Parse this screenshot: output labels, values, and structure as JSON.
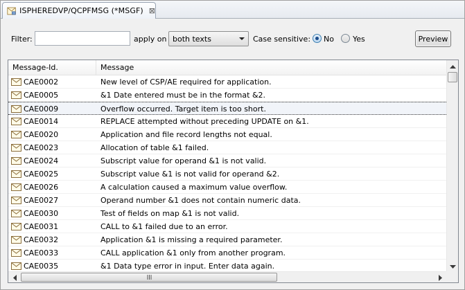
{
  "tab": {
    "title": "ISPHEREDVP/QCPFMSG (*MSGF)",
    "close_glyph": "⊠",
    "icon": "message-file-icon"
  },
  "filter": {
    "label": "Filter:",
    "value": "",
    "apply_on_label": "apply on",
    "apply_on_selected": "both texts",
    "case_label": "Case sensitive:",
    "options": [
      {
        "label": "No",
        "checked": true
      },
      {
        "label": "Yes",
        "checked": false
      }
    ],
    "preview_label": "Preview"
  },
  "table": {
    "columns": [
      "Message-Id.",
      "Message"
    ],
    "selected_index": 2,
    "row_icon": "envelope-icon",
    "rows": [
      {
        "id": "CAE0002",
        "message": "New level of CSP/AE required for application."
      },
      {
        "id": "CAE0005",
        "message": "&1 Date entered must be in the format &2."
      },
      {
        "id": "CAE0009",
        "message": "Overflow occurred. Target item is too short."
      },
      {
        "id": "CAE0014",
        "message": "REPLACE attempted without preceding UPDATE on &1."
      },
      {
        "id": "CAE0020",
        "message": "Application and file record lengths not equal."
      },
      {
        "id": "CAE0023",
        "message": "Allocation of table &1 failed."
      },
      {
        "id": "CAE0024",
        "message": "Subscript value for operand &1 is not valid."
      },
      {
        "id": "CAE0025",
        "message": "Subscript value &1 is not valid for operand &2."
      },
      {
        "id": "CAE0026",
        "message": "A calculation caused a maximum value overflow."
      },
      {
        "id": "CAE0027",
        "message": "Operand number &1 does not contain numeric data."
      },
      {
        "id": "CAE0030",
        "message": "Test of fields on map &1 is not valid."
      },
      {
        "id": "CAE0031",
        "message": "CALL to &1 failed due to an error."
      },
      {
        "id": "CAE0032",
        "message": "Application &1 is missing a required parameter."
      },
      {
        "id": "CAE0033",
        "message": "CALL application &1 only from another program."
      },
      {
        "id": "CAE0035",
        "message": "&1 Data type error in input. Enter data again."
      }
    ]
  },
  "colors": {
    "selection_bg": "#f1f4f9",
    "radio_accent": "#1d4c8a",
    "envelope_stroke": "#8a6d3b"
  }
}
